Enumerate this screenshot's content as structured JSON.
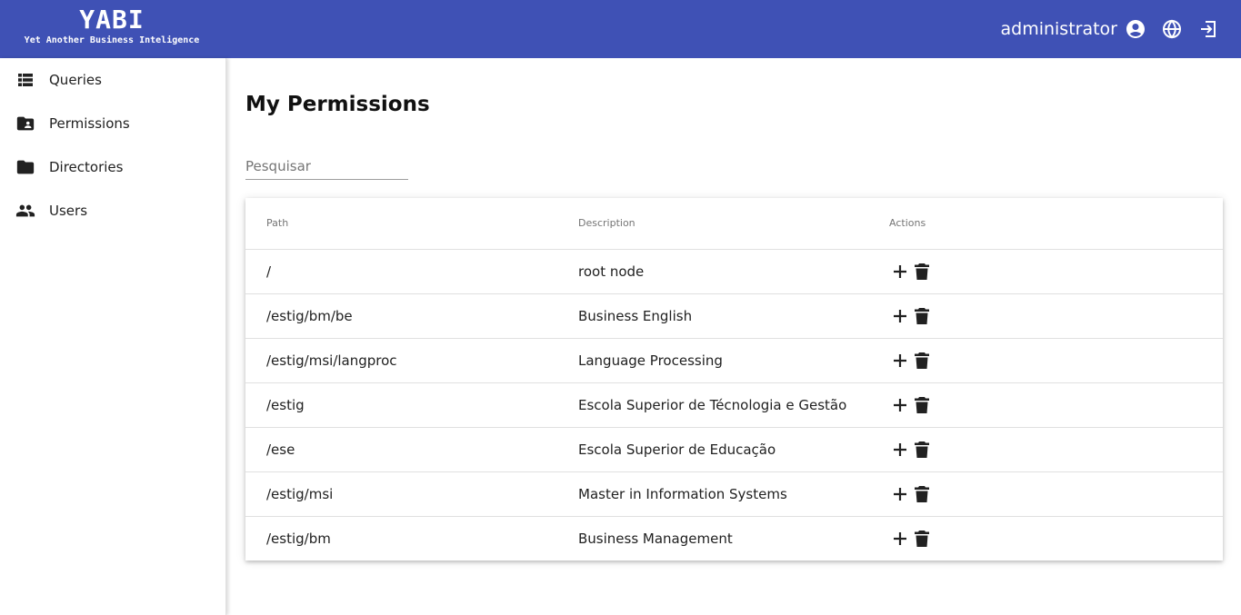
{
  "header": {
    "app_title": "YABI",
    "app_subtitle": "Yet Another Business Inteligence",
    "username": "administrator",
    "icons": [
      "account-circle-icon",
      "globe-icon",
      "logout-icon"
    ]
  },
  "sidebar": {
    "items": [
      {
        "label": "Queries",
        "icon": "view-list-icon"
      },
      {
        "label": "Permissions",
        "icon": "folder-account-icon"
      },
      {
        "label": "Directories",
        "icon": "folder-icon"
      },
      {
        "label": "Users",
        "icon": "people-icon"
      }
    ]
  },
  "main": {
    "title": "My Permissions",
    "search_placeholder": "Pesquisar",
    "table": {
      "columns": [
        "Path",
        "Description",
        "Actions"
      ],
      "rows": [
        {
          "path": "/",
          "description": "root node"
        },
        {
          "path": "/estig/bm/be",
          "description": "Business English"
        },
        {
          "path": "/estig/msi/langproc",
          "description": "Language Processing"
        },
        {
          "path": "/estig",
          "description": "Escola Superior de Técnologia e Gestão"
        },
        {
          "path": "/ese",
          "description": "Escola Superior de Educação"
        },
        {
          "path": "/estig/msi",
          "description": "Master in Information Systems"
        },
        {
          "path": "/estig/bm",
          "description": "Business Management"
        }
      ],
      "row_actions": [
        "add-icon",
        "delete-icon"
      ]
    }
  },
  "colors": {
    "primary": "#3f51b5",
    "text": "#212121",
    "muted": "#757575"
  }
}
